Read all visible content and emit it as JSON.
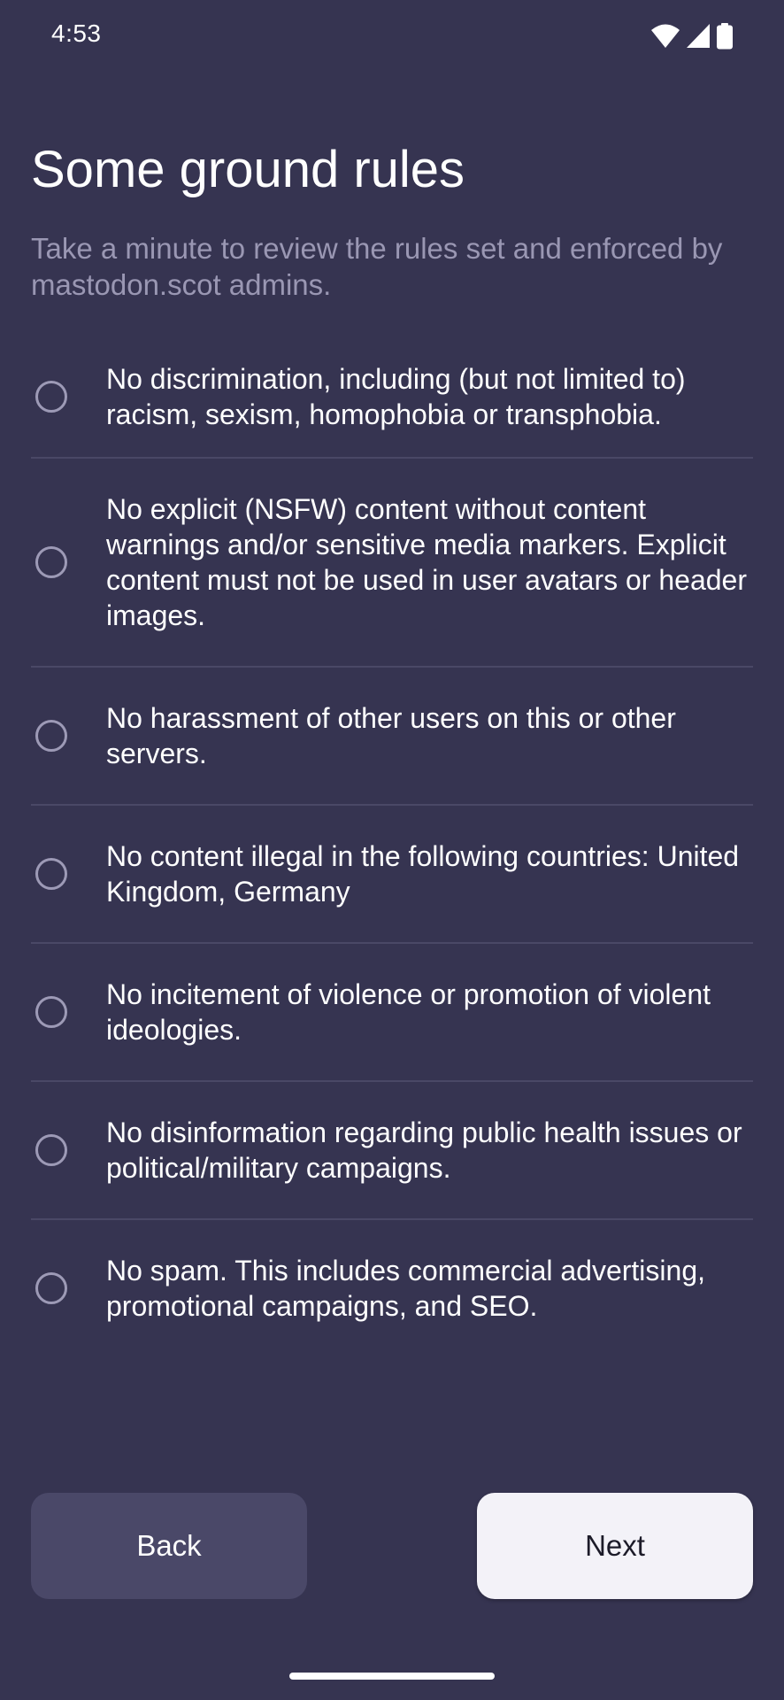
{
  "status_bar": {
    "time": "4:53",
    "icons": [
      "wifi-icon",
      "cellular-signal-icon",
      "battery-icon"
    ]
  },
  "header": {
    "title": "Some ground rules",
    "subtitle": "Take a minute to review the rules set and enforced by mastodon.scot admins."
  },
  "rules": [
    {
      "text": "No discrimination, including (but not limited to) racism, sexism, homophobia or transphobia."
    },
    {
      "text": "No explicit (NSFW) content without content warnings and/or sensitive media markers. Explicit content must not be used in user avatars or header images."
    },
    {
      "text": "No harassment of other users on this or other servers."
    },
    {
      "text": "No content illegal in the following countries: United Kingdom, Germany"
    },
    {
      "text": "No incitement of violence or promotion of violent ideologies."
    },
    {
      "text": "No disinformation regarding public health issues or political/military campaigns."
    },
    {
      "text": "No spam. This includes commercial advertising, promotional campaigns, and SEO."
    }
  ],
  "footer": {
    "back_label": "Back",
    "next_label": "Next"
  },
  "colors": {
    "background": "#363451",
    "subtitle": "#9a97b3",
    "divider": "#4a4866",
    "back_button": "#4a4868",
    "next_button": "#f3f2f8"
  }
}
